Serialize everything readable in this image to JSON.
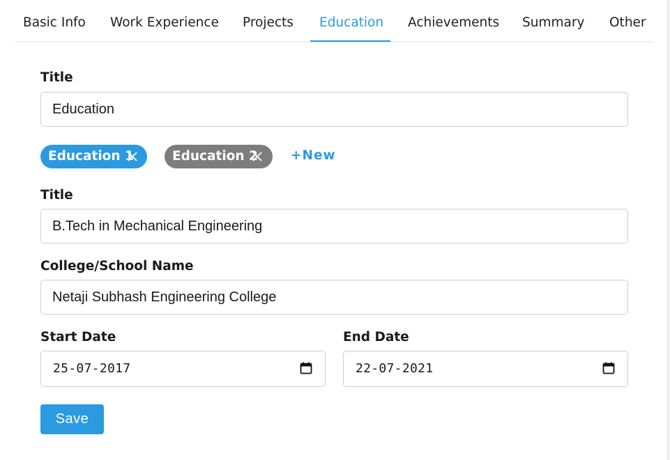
{
  "tabs": [
    {
      "label": "Basic Info"
    },
    {
      "label": "Work Experience"
    },
    {
      "label": "Projects"
    },
    {
      "label": "Education"
    },
    {
      "label": "Achievements"
    },
    {
      "label": "Summary"
    },
    {
      "label": "Other"
    }
  ],
  "active_tab": "Education",
  "accent_color": "#2b9ae0",
  "section": {
    "title_label": "Title",
    "title_value": "Education"
  },
  "entries": [
    {
      "label": "Education 1",
      "state": "active"
    },
    {
      "label": "Education 2",
      "state": "inactive"
    }
  ],
  "new_label": "+New",
  "form": {
    "title_label": "Title",
    "title_value": "B.Tech in Mechanical Engineering",
    "school_label": "College/School Name",
    "school_value": "Netaji Subhash Engineering College",
    "start_label": "Start Date",
    "start_value": "25-07-2017",
    "end_label": "End Date",
    "end_value": "22-07-2021"
  },
  "save_label": "Save"
}
